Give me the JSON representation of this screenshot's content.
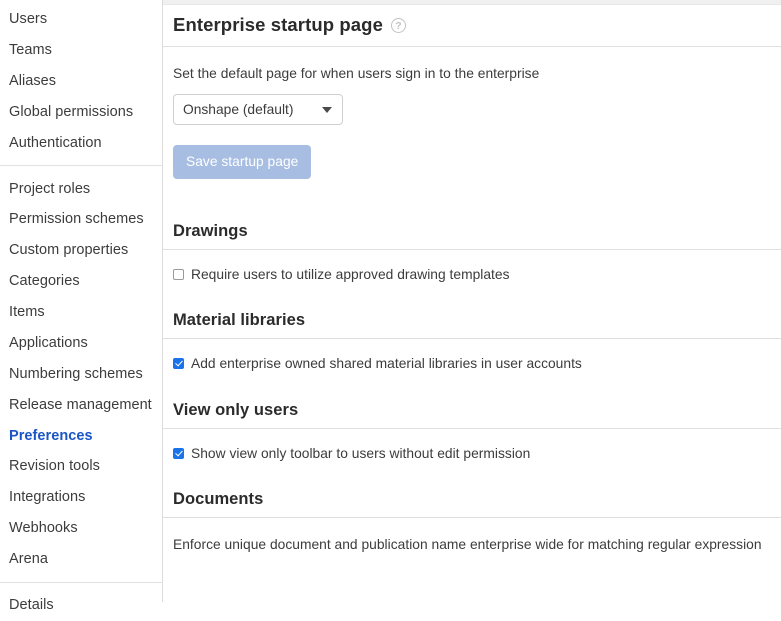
{
  "sidebar": {
    "groups": [
      {
        "items": [
          {
            "label": "Users",
            "active": false
          },
          {
            "label": "Teams",
            "active": false
          },
          {
            "label": "Aliases",
            "active": false
          },
          {
            "label": "Global permissions",
            "active": false
          },
          {
            "label": "Authentication",
            "active": false
          }
        ]
      },
      {
        "items": [
          {
            "label": "Project roles",
            "active": false
          },
          {
            "label": "Permission schemes",
            "active": false
          },
          {
            "label": "Custom properties",
            "active": false
          },
          {
            "label": "Categories",
            "active": false
          },
          {
            "label": "Items",
            "active": false
          },
          {
            "label": "Applications",
            "active": false
          },
          {
            "label": "Numbering schemes",
            "active": false
          },
          {
            "label": "Release management",
            "active": false
          },
          {
            "label": "Preferences",
            "active": true
          },
          {
            "label": "Revision tools",
            "active": false
          },
          {
            "label": "Integrations",
            "active": false
          },
          {
            "label": "Webhooks",
            "active": false
          },
          {
            "label": "Arena",
            "active": false
          }
        ]
      },
      {
        "items": [
          {
            "label": "Details",
            "active": false
          }
        ]
      }
    ]
  },
  "main": {
    "page_title": "Enterprise startup page",
    "help_icon_glyph": "?",
    "help_icon_name": "question-mark-circle-icon",
    "startup": {
      "description": "Set the default page for when users sign in to the enterprise",
      "select_value": "Onshape (default)",
      "select_options": [
        "Onshape (default)"
      ],
      "save_label": "Save startup page",
      "save_disabled": true
    },
    "sections": [
      {
        "heading": "Drawings",
        "checkbox": {
          "label": "Require users to utilize approved drawing templates",
          "checked": false
        }
      },
      {
        "heading": "Material libraries",
        "checkbox": {
          "label": "Add enterprise owned shared material libraries in user accounts",
          "checked": true
        }
      },
      {
        "heading": "View only users",
        "checkbox": {
          "label": "Show view only toolbar to users without edit permission",
          "checked": true
        }
      }
    ],
    "documents": {
      "heading": "Documents",
      "description": "Enforce unique document and publication name enterprise wide for matching regular expression"
    }
  },
  "colors": {
    "accent_blue": "#1a56c4",
    "checkbox_blue": "#1a73e8",
    "disabled_button": "#a7bde2",
    "divider": "#e0e0e0",
    "text": "#3c3c3c"
  }
}
